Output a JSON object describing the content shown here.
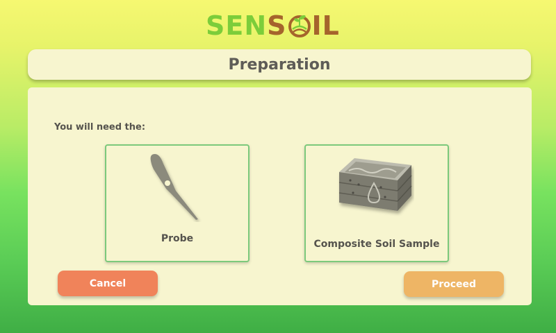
{
  "brand": {
    "logo_text_part1": "SEN",
    "logo_text_part2": "S",
    "logo_text_part3": "IL",
    "colors": {
      "green": "#7ccd3a",
      "brown": "#a5642c"
    }
  },
  "header": {
    "title": "Preparation"
  },
  "main": {
    "intro": "You will need the:",
    "items": [
      {
        "label": "Probe",
        "icon": "probe-icon"
      },
      {
        "label": "Composite Soil Sample",
        "icon": "soil-sample-crate-icon"
      }
    ]
  },
  "actions": {
    "cancel_label": "Cancel",
    "proceed_label": "Proceed",
    "colors": {
      "cancel": "#f0835a",
      "proceed": "#eeb565"
    }
  }
}
